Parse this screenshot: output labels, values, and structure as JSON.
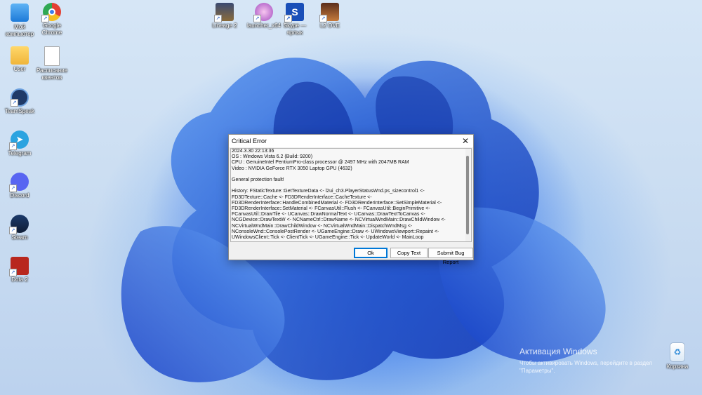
{
  "desktop": {
    "icons_left": [
      {
        "label": "Мой компьютер",
        "icon": "computer-icon"
      },
      {
        "label": "Google Chrome",
        "icon": "chrome-icon"
      },
      {
        "label": "User",
        "icon": "folder-icon"
      },
      {
        "label": "Расписание квентов",
        "icon": "document-icon"
      },
      {
        "label": "TeamSpeak",
        "icon": "teamspeak-icon"
      },
      {
        "label": "Telegram",
        "icon": "telegram-icon"
      },
      {
        "label": "Discord",
        "icon": "discord-icon"
      },
      {
        "label": "Steam",
        "icon": "steam-icon"
      },
      {
        "label": "Dota 2",
        "icon": "dota-icon"
      }
    ],
    "icons_top": [
      {
        "label": "Lineage 2",
        "icon": "lineage-icon"
      },
      {
        "label": "launcher_x64",
        "icon": "launcher-icon"
      },
      {
        "label": "Skype — ярлык",
        "icon": "skype-icon"
      },
      {
        "label": "L2 OVE",
        "icon": "l2ove-icon"
      }
    ],
    "recycle_bin": {
      "label": "Корзина",
      "icon": "recycle-bin-icon"
    },
    "activation": {
      "line1": "Активация Windows",
      "line2": "Чтобы активировать Windows, перейдите в раздел",
      "line3": "\"Параметры\"."
    }
  },
  "dialog": {
    "title": "Critical Error",
    "close_glyph": "✕",
    "lines": [
      "2024.3.30 22:13:36",
      "OS : Windows Vista 6.2 (Build: 9200)",
      "CPU : GenuineIntel PentiumPro-class processor @ 2497 MHz with 2047MB RAM",
      "Video : NVIDIA GeForce RTX 3050 Laptop GPU (4632)",
      "",
      "General protection fault!",
      "",
      "History: FStaticTexture::GetTextureData <- l2ui_ch3.PlayerStatusWnd.ps_sizecontrol1 <-",
      "FD3DTexture::Cache <- FD3DRenderInterface::CacheTexture <-",
      "FD3DRenderInterface::HandleCombinedMaterial <- FD3DRenderInterface::SetSimpleMaterial <-",
      "FD3DRenderInterface::SetMaterial <- FCanvasUtil::Flush <- FCanvasUtil::BeginPrimitive <-",
      "FCanvasUtil::DrawTile <- UCanvas::DrawNormalText <- UCanvas::DrawTextToCanvas <-",
      "NCGDevice::DrawTextW <- NCNameCtrl::DrawName <- NCVirtualWndMain::DrawChildWindow <-",
      "NCVirtualWndMain::DrawChildWindow <- NCVirtualWndMain::DispatchWndMsg <-",
      "NConsoleWnd::ConsolePostRender <- UGameEngine::Draw <- UWindowsViewport::Repaint <-",
      "UWindowsClient::Tick <- ClientTick <- UGameEngine::Tick <- UpdateWorld <- MainLoop"
    ],
    "buttons": {
      "ok": "Ok",
      "copy": "Copy Text",
      "report": "Submit Bug Report"
    }
  }
}
